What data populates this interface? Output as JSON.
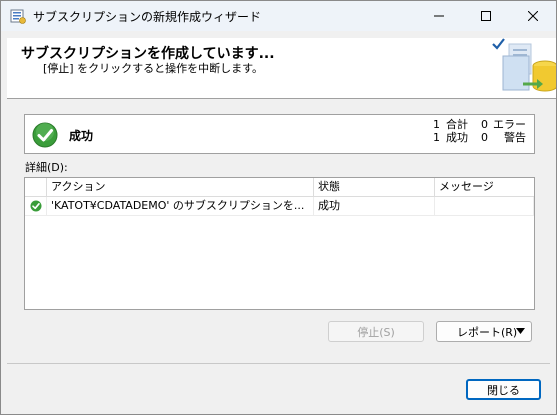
{
  "window": {
    "title": "サブスクリプションの新規作成ウィザード"
  },
  "header": {
    "title": "サブスクリプションを作成しています...",
    "subtitle": "[停止] をクリックすると操作を中断します。"
  },
  "status": {
    "label": "成功",
    "total_count": "1",
    "total_label": "合計",
    "error_count": "0",
    "error_label": "エラー",
    "success_count": "1",
    "success_label": "成功",
    "warning_count": "0",
    "warning_label": "警告"
  },
  "details": {
    "label": "詳細(D):",
    "columns": [
      "アクション",
      "状態",
      "メッセージ"
    ],
    "rows": [
      {
        "action": "'KATOT¥CDATADEMO' のサブスクリプションを...",
        "status": "成功",
        "message": ""
      }
    ]
  },
  "buttons": {
    "stop": "停止(S)",
    "report": "レポート(R)",
    "close": "閉じる"
  },
  "colors": {
    "success_green": "#3a9d3a",
    "accent_blue": "#0067c0"
  }
}
